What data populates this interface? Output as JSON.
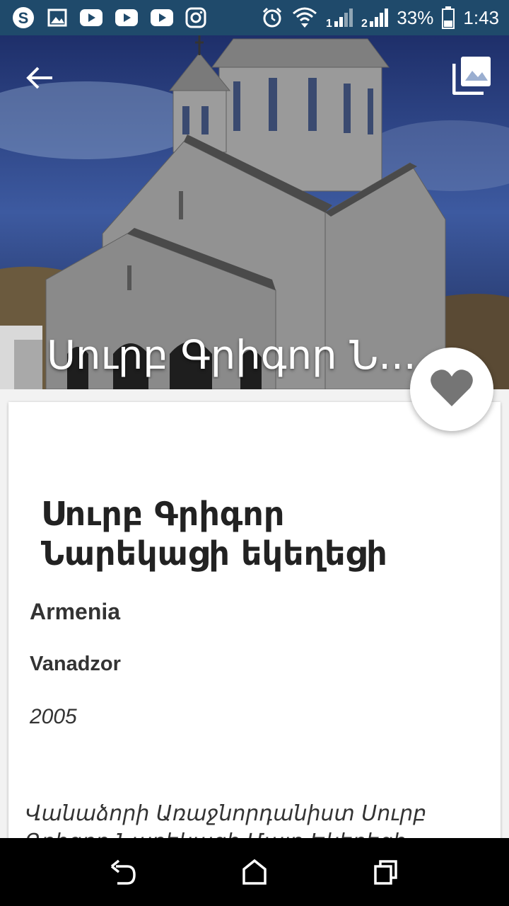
{
  "status_bar": {
    "battery": "33%",
    "time": "1:43",
    "left_icons": [
      "skype-icon",
      "image-icon",
      "youtube-icon",
      "youtube-icon",
      "youtube-icon",
      "instagram-icon"
    ],
    "right_icons": [
      "alarm-icon",
      "wifi-icon",
      "signal-1-icon",
      "signal-2-icon",
      "battery-icon"
    ]
  },
  "hero": {
    "title": "Սուրբ Գրիգոր Ն...",
    "back_icon": "arrow-left-icon",
    "gallery_icon": "photo-library-icon"
  },
  "favorite": {
    "icon": "heart-icon",
    "color": "#757575"
  },
  "church": {
    "name": "Սուրբ Գրիգոր Նարեկացի եկեղեցի",
    "country": "Armenia",
    "city": "Vanadzor",
    "year": "2005",
    "description": "Վանաձորի Առաջնորդանիստ Սուրբ Գրիգոր Նարեկացի Մայր Եկեղեցի"
  },
  "nav_bar": {
    "back_icon": "back-icon",
    "home_icon": "home-icon",
    "recents_icon": "recents-icon"
  },
  "colors": {
    "status_bar": "#1f4a6b",
    "sky": "#2c3f7a",
    "card": "#ffffff"
  }
}
